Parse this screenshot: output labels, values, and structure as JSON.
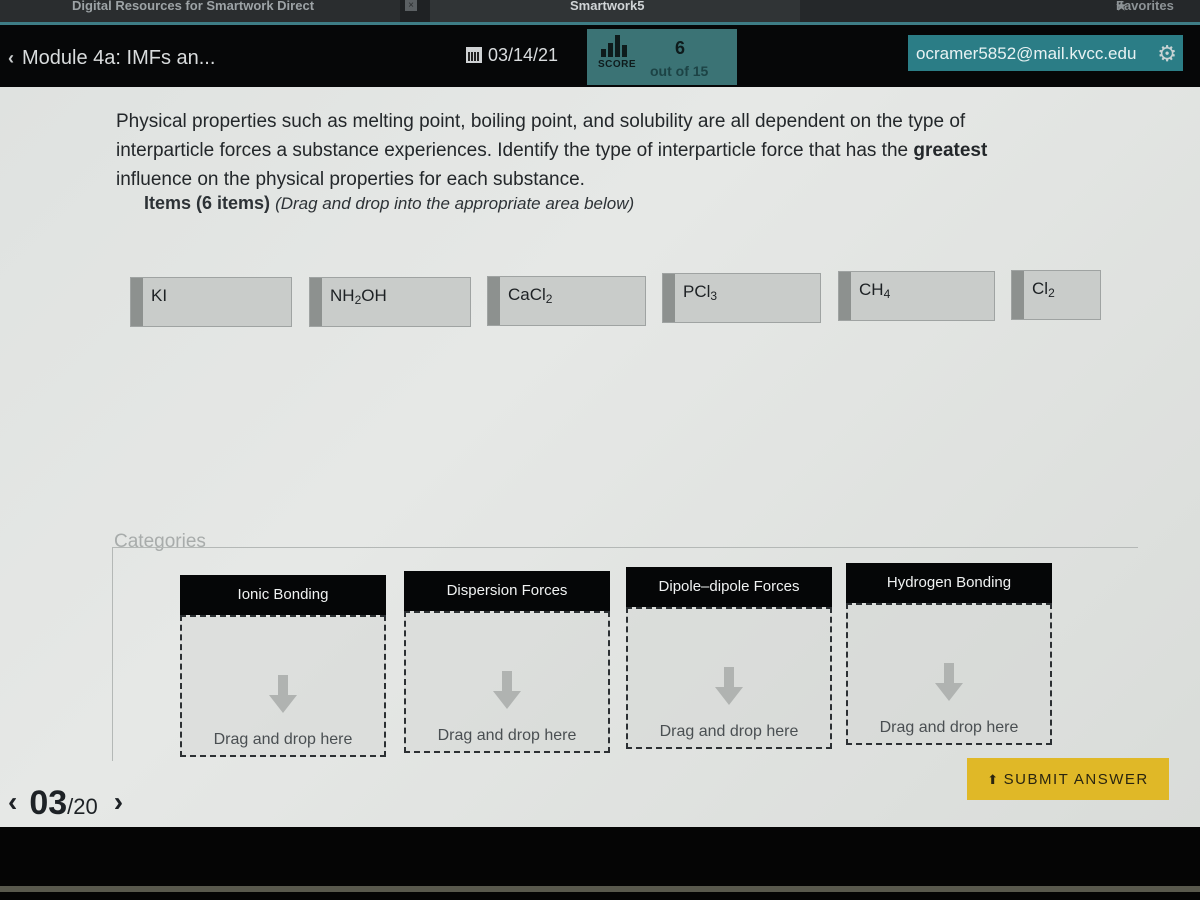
{
  "browser": {
    "tabs": [
      {
        "label": "Digital Resources for Smartwork Direct"
      },
      {
        "label": "Smartwork5"
      },
      {
        "label": "Favorites"
      }
    ],
    "close_glyph": "×"
  },
  "header": {
    "back_glyph": "‹",
    "assignment_title": "Module 4a: IMFs an...",
    "due_date": "03/14/21",
    "score": {
      "label": "SCORE",
      "value": "6",
      "out_of": "out of 15"
    },
    "user_email": "ocramer5852@mail.kvcc.edu",
    "gear_glyph": "✱"
  },
  "question": {
    "prompt_part1": "Physical properties such as melting point, boiling point, and solubility are all dependent on the type of interparticle forces a substance experiences. Identify the type of interparticle force that has the ",
    "prompt_emphasis": "greatest",
    "prompt_part2": " influence on the physical properties for each substance.",
    "items_heading": "Items (6 items)",
    "items_instruction": "(Drag and drop into the appropriate area below)",
    "items": [
      {
        "base": "KI",
        "sub": "",
        "tail": ""
      },
      {
        "base": "NH",
        "sub": "2",
        "tail": "OH"
      },
      {
        "base": "CaCl",
        "sub": "2",
        "tail": ""
      },
      {
        "base": "PCl",
        "sub": "3",
        "tail": ""
      },
      {
        "base": "CH",
        "sub": "4",
        "tail": ""
      },
      {
        "base": "Cl",
        "sub": "2",
        "tail": ""
      }
    ],
    "categories_label": "Categories",
    "categories": [
      {
        "label": "Ionic Bonding",
        "drop_text": "Drag and drop here"
      },
      {
        "label": "Dispersion Forces",
        "drop_text": "Drag and drop here"
      },
      {
        "label": "Dipole–dipole Forces",
        "drop_text": "Drag and drop here"
      },
      {
        "label": "Hydrogen Bonding",
        "drop_text": "Drag and drop here"
      }
    ]
  },
  "footer": {
    "submit_label": "SUBMIT ANSWER",
    "pager": {
      "prev_glyph": "‹",
      "current": "03",
      "total": "/20",
      "next_glyph": "›"
    }
  },
  "colors": {
    "accent_teal": "#2b7d86",
    "score_bg": "#3b7375",
    "submit_yellow": "#e0b827",
    "category_header": "#050607"
  }
}
